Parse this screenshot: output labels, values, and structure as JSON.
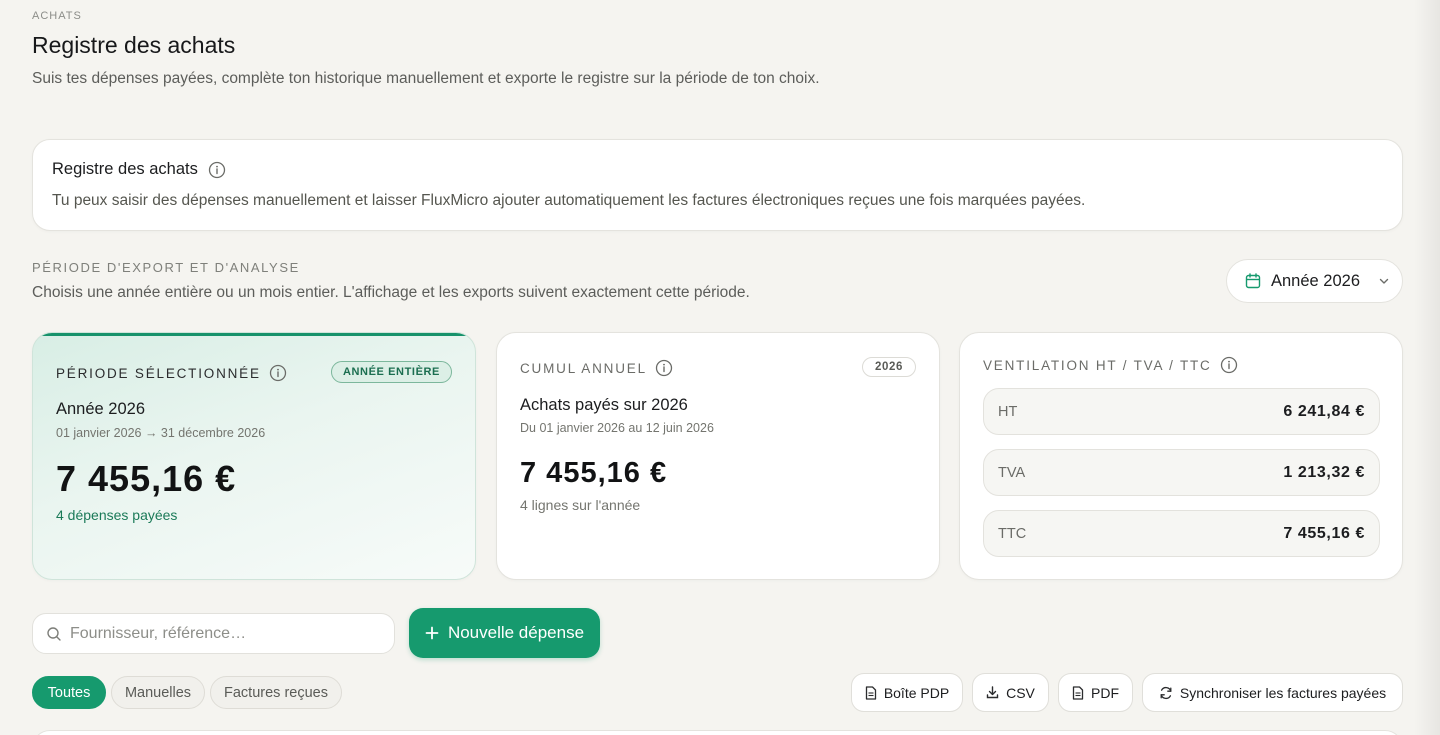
{
  "header": {
    "eyebrow": "ACHATS",
    "title": "Registre des achats",
    "subtitle": "Suis tes dépenses payées, complète ton historique manuellement et exporte le registre sur la période de ton choix."
  },
  "info_card": {
    "title": "Registre des achats",
    "description": "Tu peux saisir des dépenses manuellement et laisser FluxMicro ajouter automatiquement les factures électroniques reçues une fois marquées payées."
  },
  "period": {
    "label": "PÉRIODE D'EXPORT ET D'ANALYSE",
    "description": "Choisis une année entière ou un mois entier. L'affichage et les exports suivent exactement cette période.",
    "selected": "Année 2026"
  },
  "cards": {
    "selected": {
      "label": "PÉRIODE SÉLECTIONNÉE",
      "badge": "ANNÉE ENTIÈRE",
      "subtitle": "Année 2026",
      "range": "01 janvier 2026 → 31 décembre 2026",
      "amount": "7 455,16 €",
      "count": "4 dépenses payées"
    },
    "cumul": {
      "label": "CUMUL ANNUEL",
      "badge": "2026",
      "subtitle": "Achats payés sur 2026",
      "range": "Du 01 janvier 2026 au 12 juin 2026",
      "amount": "7 455,16 €",
      "count": "4 lignes sur l'année"
    },
    "ventilation": {
      "label": "VENTILATION HT / TVA / TTC",
      "rows": [
        {
          "key": "HT",
          "value": "6 241,84 €"
        },
        {
          "key": "TVA",
          "value": "1 213,32 €"
        },
        {
          "key": "TTC",
          "value": "7 455,16 €"
        }
      ]
    }
  },
  "toolbar": {
    "search_placeholder": "Fournisseur, référence…",
    "new_expense_label": "Nouvelle dépense",
    "filters": [
      "Toutes",
      "Manuelles",
      "Factures reçues"
    ],
    "boite_pdp_label": "Boîte PDP",
    "csv_label": "CSV",
    "pdf_label": "PDF",
    "sync_label": "Synchroniser les factures payées"
  },
  "colors": {
    "accent": "#169a6e",
    "background": "#f5f4f0"
  }
}
